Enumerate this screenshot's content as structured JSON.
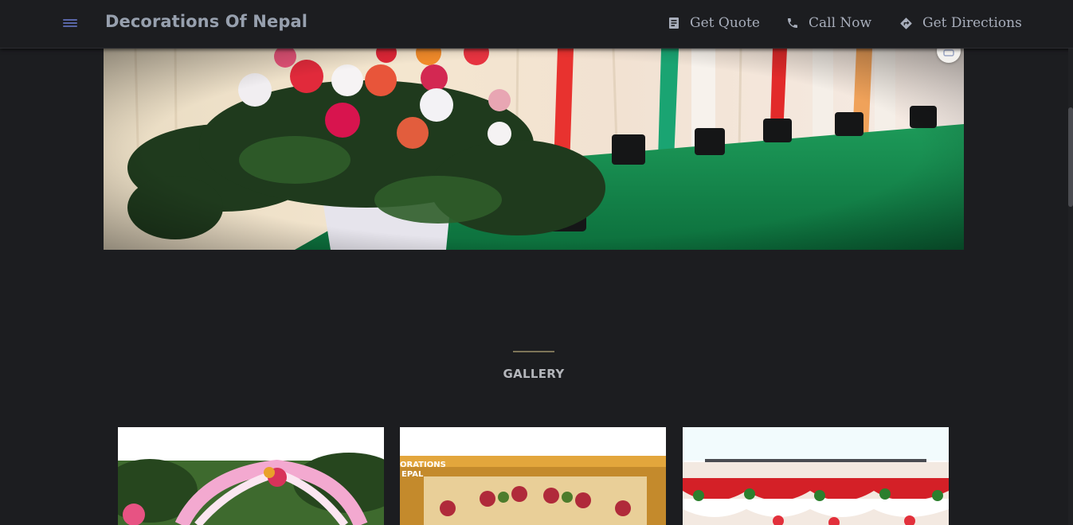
{
  "header": {
    "brand": "Decorations Of Nepal",
    "menu_icon": "hamburger-menu-icon",
    "actions": [
      {
        "label": "Get Quote",
        "icon": "document-icon"
      },
      {
        "label": "Call Now",
        "icon": "phone-icon"
      },
      {
        "label": "Get Directions",
        "icon": "directions-icon"
      }
    ]
  },
  "hero": {
    "subject": "flower arrangement on stage with lights",
    "icon": "link-icon"
  },
  "gallery": {
    "title": "GALLERY",
    "items": [
      {
        "subject": "pink and white fabric arch with flowers"
      },
      {
        "subject": "stage backdrop with flower garlands",
        "watermark": "ORATIONS\nEPAL"
      },
      {
        "subject": "red and white draped stage with flowers"
      }
    ]
  },
  "colors": {
    "background": "#1c1d20",
    "brand": "#97a0ae",
    "menu_icon": "#5865a6",
    "nav_text": "#a8aebb",
    "section_rule": "#7d7458",
    "section_title": "#b4b6bb"
  }
}
